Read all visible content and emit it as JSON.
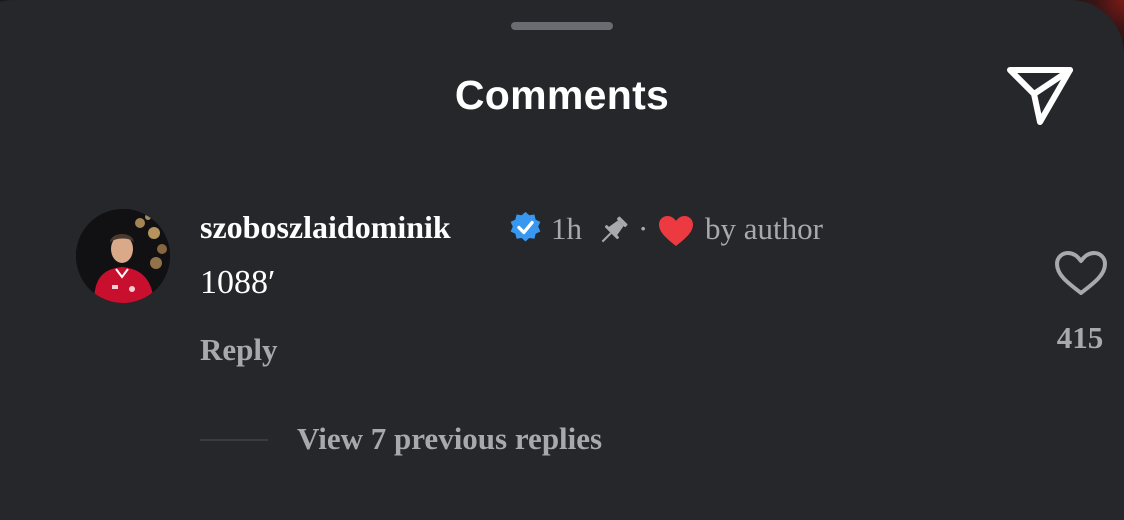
{
  "sheet": {
    "title": "Comments",
    "share_icon": "paper-plane-icon"
  },
  "comment": {
    "avatar_icon": "profile-photo",
    "username": "szoboszlaidominik",
    "verified_icon": "verified-badge-icon",
    "time": "1h",
    "pin_icon": "pin-icon",
    "separator": "·",
    "liked_by_icon": "heart-filled-icon",
    "liked_by_text": "by author",
    "text": "1088′",
    "reply_label": "Reply",
    "like_icon": "heart-outline-icon",
    "like_count": "415",
    "view_replies_label": "View 7 previous replies"
  },
  "colors": {
    "sheet_bg": "#26272b",
    "primary_text": "#ffffff",
    "secondary_text": "#a8a9ad",
    "verified_blue": "#3897f0",
    "heart_red": "#ed3a41"
  }
}
